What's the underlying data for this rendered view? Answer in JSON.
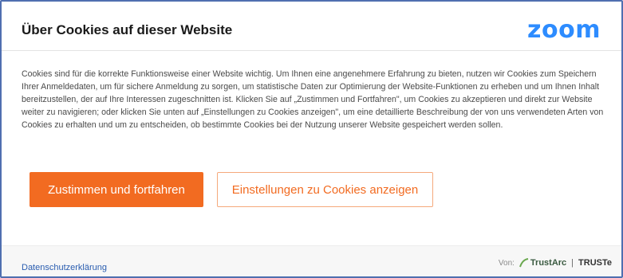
{
  "dialog": {
    "title": "Über Cookies auf dieser Website",
    "logo_text": "zoom",
    "brand_color": "#2d8cff",
    "accent_color": "#f26b21",
    "body": "Cookies sind für die korrekte Funktionsweise einer Website wichtig. Um Ihnen eine angenehmere Erfahrung zu bieten, nutzen wir Cookies zum Speichern Ihrer Anmeldedaten, um für sichere Anmeldung zu sorgen, um statistische Daten zur Optimierung der Website-Funktionen zu erheben und um Ihnen Inhalt bereitzustellen, der auf Ihre Interessen zugeschnitten ist. Klicken Sie auf „Zustimmen und Fortfahren\", um Cookies zu akzeptieren und direkt zur Website weiter zu navigieren; oder klicken Sie unten auf „Einstellungen zu Cookies anzeigen\", um eine detaillierte Beschreibung der von uns verwendeten Arten von Cookies zu erhalten und um zu entscheiden, ob bestimmte Cookies bei der Nutzung unserer Website gespeichert werden sollen.",
    "accept_label": "Zustimmen und fortfahren",
    "settings_label": "Einstellungen zu Cookies anzeigen"
  },
  "footer": {
    "privacy_link": "Datenschutzerklärung",
    "by_label": "Von:",
    "trustarc": "TrustArc",
    "separator": "|",
    "truste": "TRUSTe"
  }
}
